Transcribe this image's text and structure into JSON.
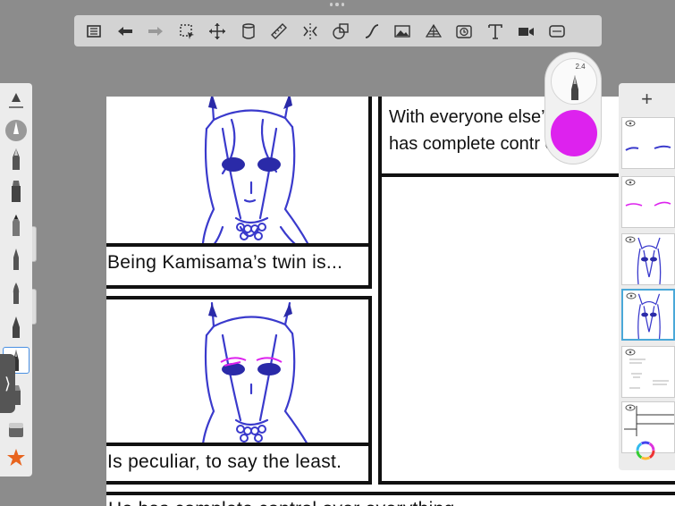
{
  "toolbar": {
    "tools": [
      "menu-icon",
      "undo-icon",
      "redo-icon",
      "selection-icon",
      "transform-icon",
      "flip-icon",
      "ruler-icon",
      "symmetry-icon",
      "shapes-icon",
      "curve-icon",
      "image-icon",
      "perspective-icon",
      "timelapse-icon",
      "text-icon",
      "video-icon",
      "fullscreen-icon"
    ]
  },
  "brushes": [
    "brush-slider-icon",
    "airbrush-icon",
    "pen-icon",
    "marker-icon",
    "pencil-icon",
    "fine-pen-icon",
    "ink-brush-icon",
    "calligraphy-icon",
    "active-brush-icon",
    "smudge-icon",
    "eraser-icon",
    "star-brush-icon"
  ],
  "puck": {
    "size": "2.4",
    "color": "#dd22ee"
  },
  "captions": {
    "panel1": "Being Kamisama’s twin is...",
    "panel2": "Is peculiar, to say the least.",
    "panel3_line1": "With everyone else’s th",
    "panel3_line2": "has complete contr     er",
    "bottom": "He has complete control over everything"
  },
  "layers": {
    "add_label": "+",
    "count": 6,
    "active_index": 3
  },
  "colors": {
    "sketch": "#3a3acc",
    "accent": "#dd22ee",
    "toolbar": "#d3d3d3"
  }
}
